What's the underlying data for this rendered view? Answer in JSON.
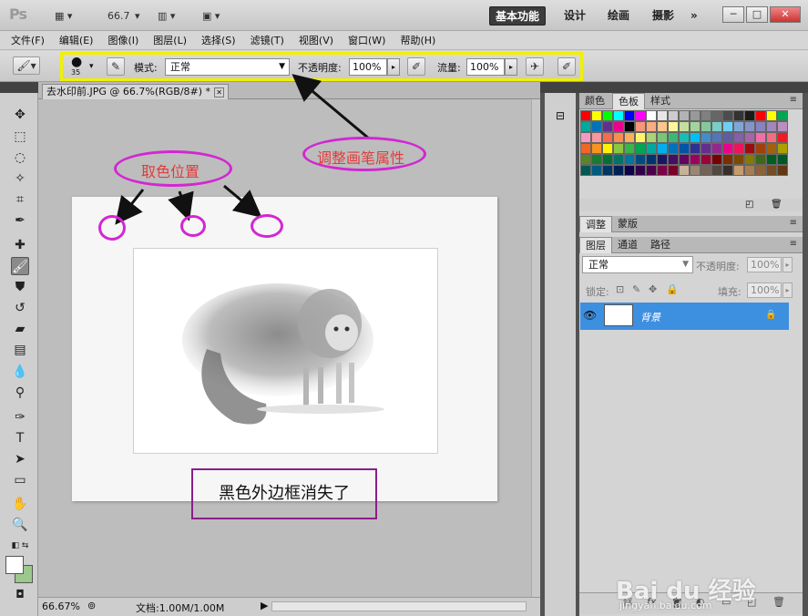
{
  "appbar": {
    "logo": "Ps",
    "zoom_value": "66.7",
    "workspaces": [
      "基本功能",
      "设计",
      "绘画",
      "摄影"
    ],
    "more": "»",
    "window_controls": [
      "─",
      "□",
      "✕"
    ]
  },
  "menu": [
    "文件(F)",
    "编辑(E)",
    "图像(I)",
    "图层(L)",
    "选择(S)",
    "滤镜(T)",
    "视图(V)",
    "窗口(W)",
    "帮助(H)"
  ],
  "options": {
    "brush_size": "35",
    "mode_label": "模式:",
    "mode_value": "正常",
    "opacity_label": "不透明度:",
    "opacity_value": "100%",
    "flow_label": "流量:",
    "flow_value": "100%"
  },
  "document": {
    "tab_title": "去水印前.JPG @ 66.7%(RGB/8#) *",
    "tab_close": "✕",
    "status_zoom": "66.67%",
    "status_doc": "文档:1.00M/1.00M"
  },
  "panels": {
    "swatch_tabs": [
      "颜色",
      "色板",
      "样式"
    ],
    "adjust_tabs": [
      "调整",
      "蒙版"
    ],
    "layer_tabs": [
      "图层",
      "通道",
      "路径"
    ],
    "blend_mode": "正常",
    "opacity_label": "不透明度:",
    "opacity_value": "100%",
    "lock_label": "锁定:",
    "fill_label": "填充:",
    "fill_value": "100%",
    "layer_name": "背景",
    "footer_icons": [
      "link-icon",
      "fx-icon",
      "mask-icon",
      "adjustment-icon",
      "group-icon",
      "new-layer-icon",
      "trash-icon"
    ]
  },
  "swatches": [
    "#ff0000",
    "#ffff00",
    "#00ff00",
    "#00ffff",
    "#0000ff",
    "#ff00ff",
    "#ffffff",
    "#e6e6e6",
    "#cccccc",
    "#b3b3b3",
    "#999999",
    "#808080",
    "#666666",
    "#4d4d4d",
    "#333333",
    "#1a1a1a",
    "#ff0000",
    "#ffff00",
    "#00a651",
    "#00a99d",
    "#0072bc",
    "#662d91",
    "#ec008c",
    "#000000",
    "#f7977a",
    "#f9ad81",
    "#fdc68a",
    "#fff79a",
    "#c4df9b",
    "#a3d39c",
    "#82ca9d",
    "#7bcdc8",
    "#6ecff6",
    "#7ea7d8",
    "#8493ca",
    "#8882be",
    "#a187be",
    "#bc8dbf",
    "#f49ac2",
    "#f6989d",
    "#f26c4f",
    "#f68e55",
    "#fbaf5c",
    "#fff467",
    "#acd372",
    "#7cc576",
    "#3bb878",
    "#1abbb4",
    "#00bff3",
    "#438ccb",
    "#5574b9",
    "#605ca8",
    "#855fa8",
    "#a864a8",
    "#f06eaa",
    "#f26d7d",
    "#ed1c24",
    "#f26522",
    "#f7941d",
    "#fff200",
    "#8dc73f",
    "#39b54a",
    "#00a651",
    "#00a99d",
    "#00aeef",
    "#0072bc",
    "#0054a6",
    "#2e3192",
    "#662d91",
    "#92278f",
    "#ec008c",
    "#ed145b",
    "#9e0b0f",
    "#a0410d",
    "#a36209",
    "#aba000",
    "#598527",
    "#1a7b30",
    "#007236",
    "#00746b",
    "#0076a3",
    "#004b80",
    "#003471",
    "#1b1464",
    "#440e62",
    "#630460",
    "#9e005d",
    "#9e0039",
    "#790000",
    "#7b2e00",
    "#7d4900",
    "#827b00",
    "#406618",
    "#005e20",
    "#005826",
    "#005952",
    "#005b7f",
    "#003663",
    "#002157",
    "#0d004c",
    "#32004b",
    "#4b0049",
    "#7b0046",
    "#7a0026",
    "#c7b299",
    "#998675",
    "#736357",
    "#534741",
    "#37302a",
    "#c69c6d",
    "#a67c52",
    "#8c6239",
    "#754c24",
    "#603913"
  ],
  "annotations": {
    "pick_color": "取色位置",
    "adjust_brush": "调整画笔属性",
    "note": "黑色外边框消失了"
  },
  "watermark": {
    "brand": "Bai du 经验",
    "url": "jingyan.baidu.com"
  }
}
